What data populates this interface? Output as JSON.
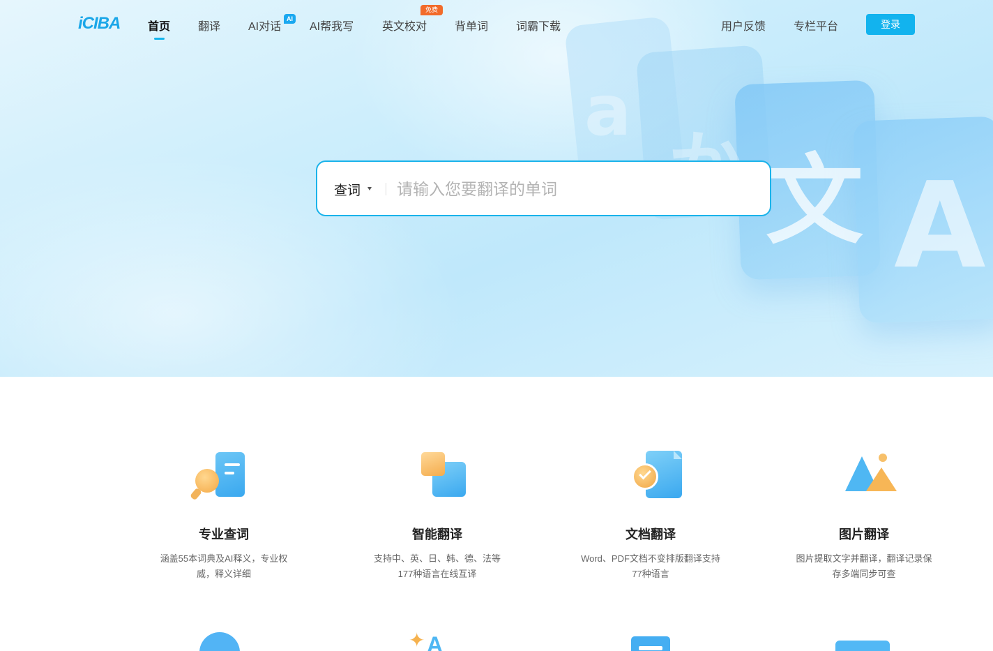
{
  "nav": {
    "logo": "iCIBA",
    "items": [
      {
        "label": "首页",
        "active": true
      },
      {
        "label": "翻译"
      },
      {
        "label": "AI对话",
        "badge": "AI"
      },
      {
        "label": "AI帮我写"
      },
      {
        "label": "英文校对",
        "badge": "免费"
      },
      {
        "label": "背单词"
      },
      {
        "label": "词霸下载"
      }
    ],
    "right_items": [
      {
        "label": "用户反馈"
      },
      {
        "label": "专栏平台"
      }
    ],
    "login_label": "登录"
  },
  "search": {
    "mode_label": "查词",
    "placeholder": "请输入您要翻译的单词",
    "value": ""
  },
  "hero_decor": {
    "glyphs": [
      "文",
      "A",
      "か",
      "a"
    ]
  },
  "features": [
    {
      "title": "专业查词",
      "desc": "涵盖55本词典及AI释义，专业权威，释义详细",
      "icon": "dictionary-search-icon"
    },
    {
      "title": "智能翻译",
      "desc": "支持中、英、日、韩、德、法等177种语言在线互译",
      "icon": "smart-translate-icon"
    },
    {
      "title": "文档翻译",
      "desc": "Word、PDF文档不变排版翻译支持77种语言",
      "icon": "document-translate-icon"
    },
    {
      "title": "图片翻译",
      "desc": "图片提取文字并翻译，翻译记录保存多端同步可查",
      "icon": "image-translate-icon"
    }
  ],
  "colors": {
    "accent": "#14b4ec",
    "ai_badge": "#19a8f0",
    "free_badge": "#f26b2a"
  }
}
